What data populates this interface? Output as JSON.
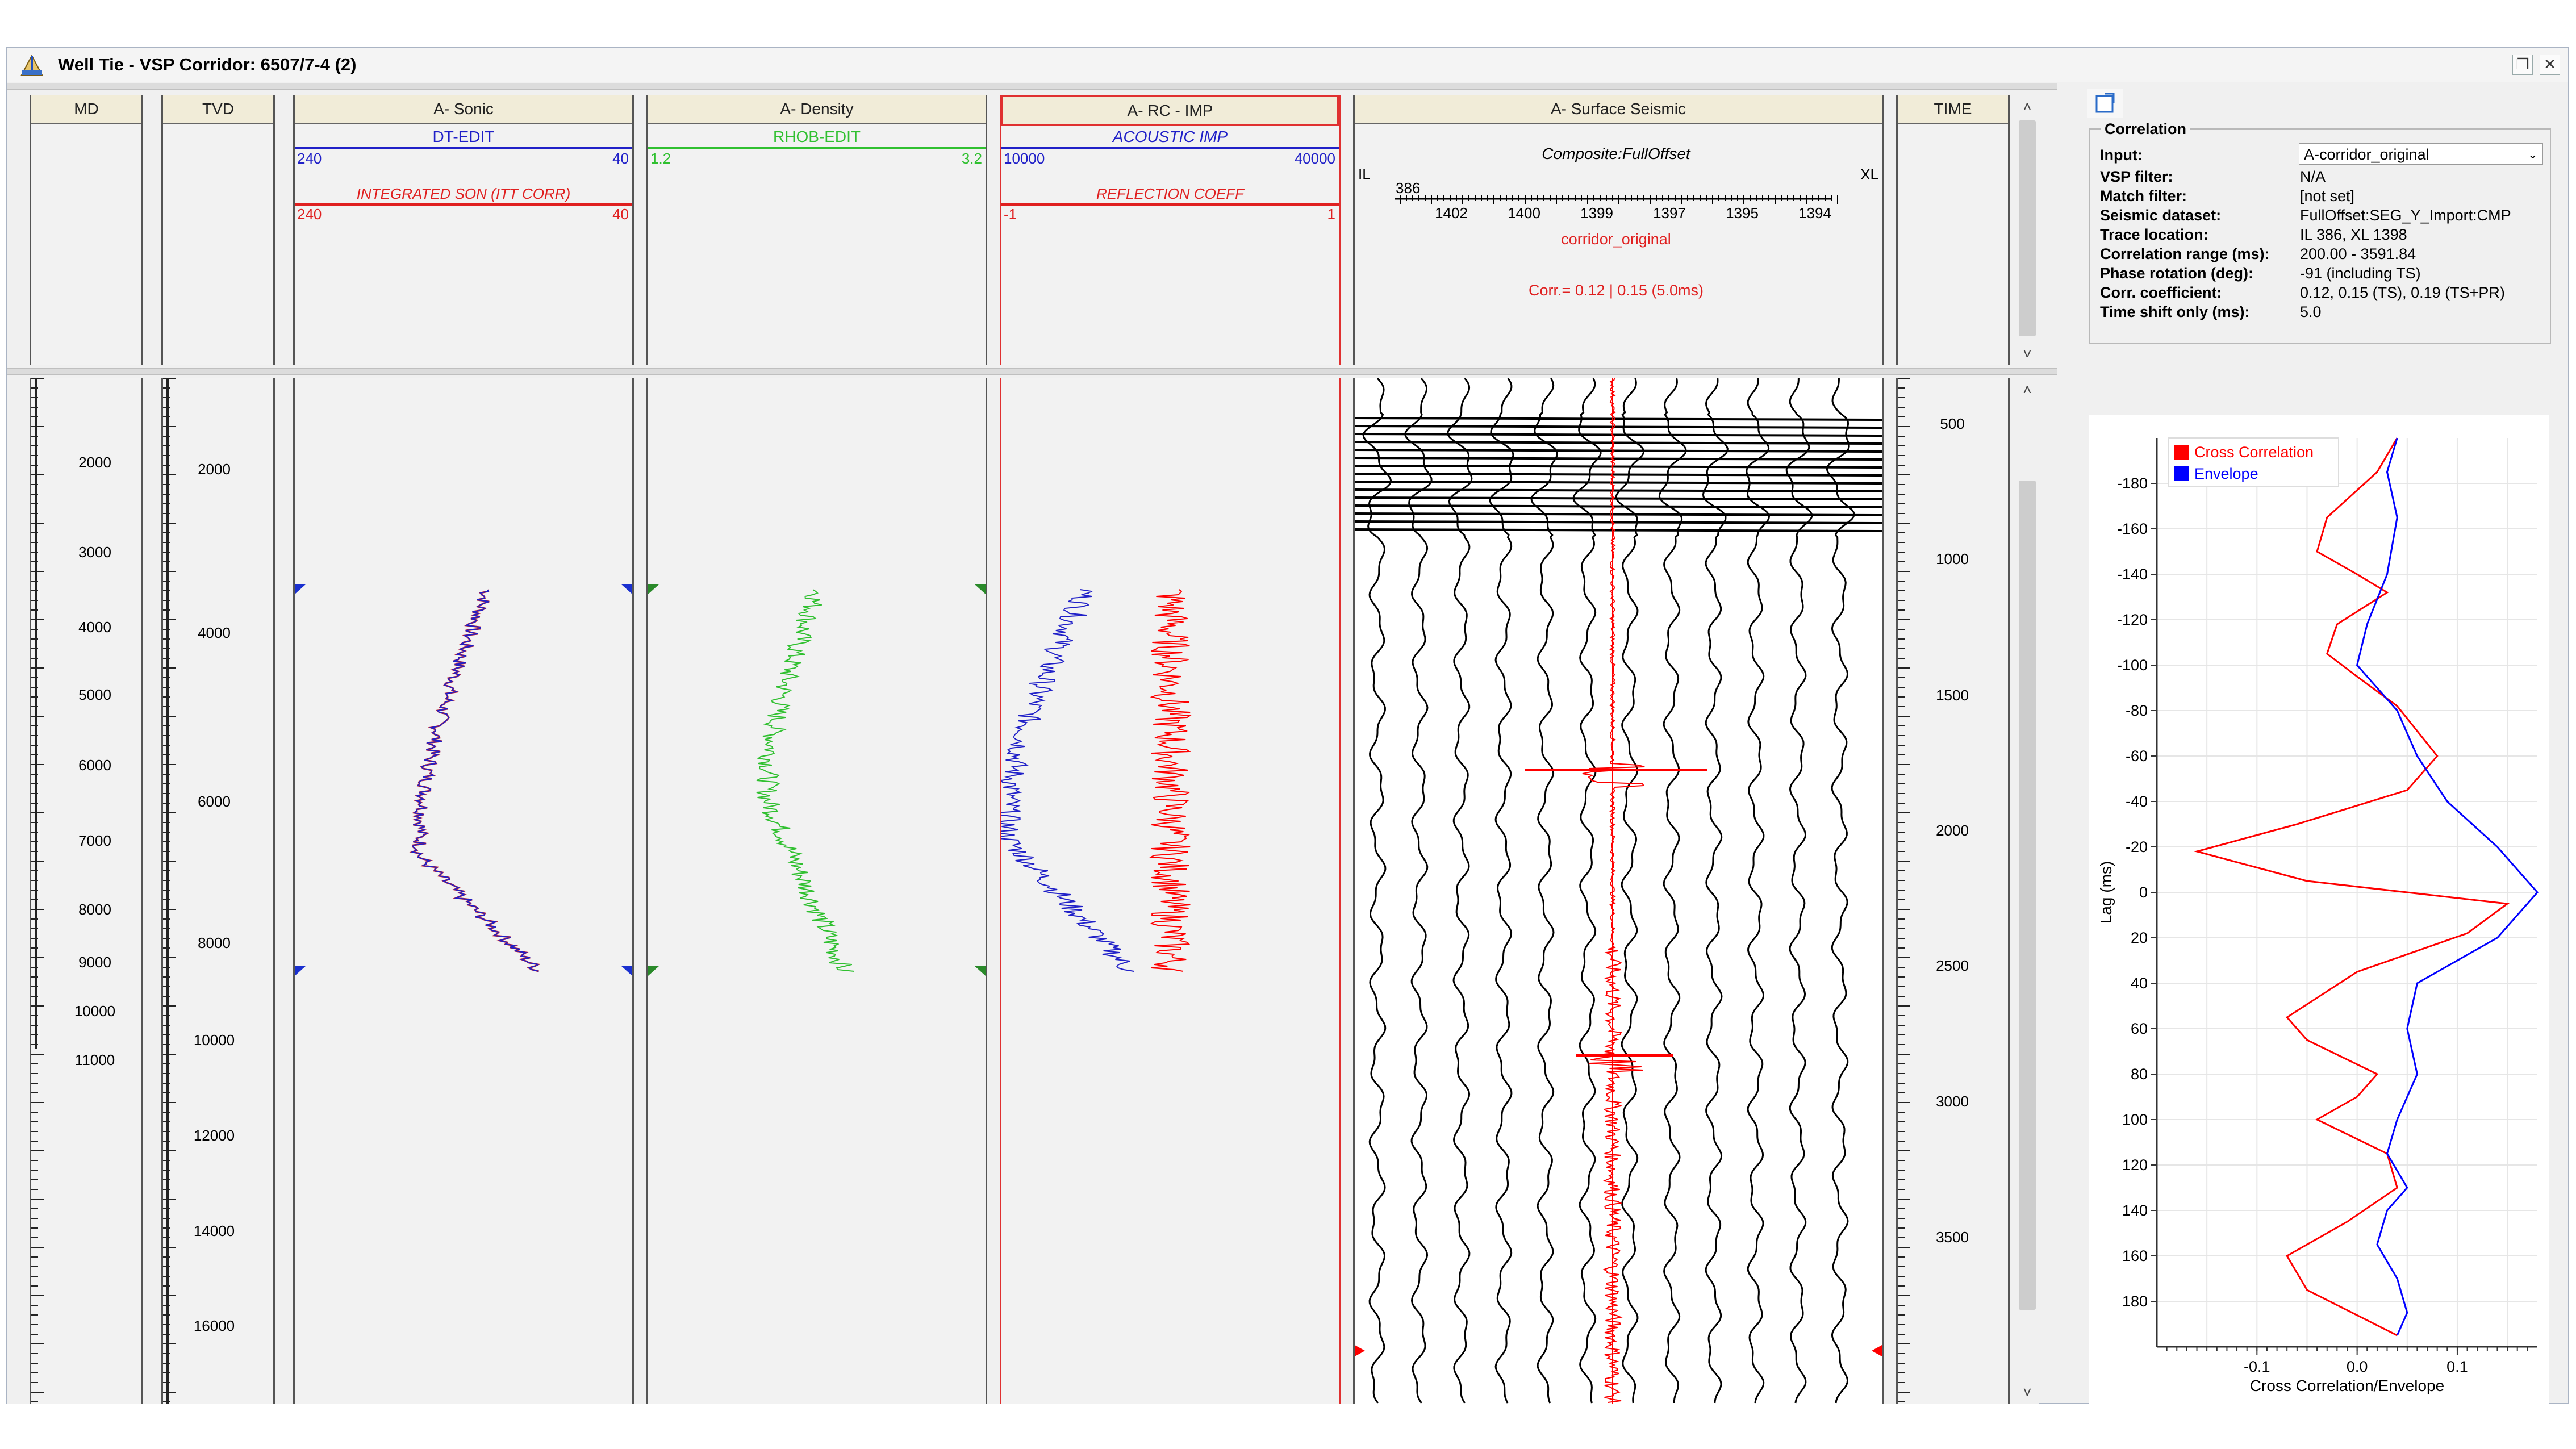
{
  "window": {
    "title": "Well Tie - VSP Corridor: 6507/7-4 (2)",
    "restore_glyph": "❐",
    "close_glyph": "✕"
  },
  "scroll": {
    "up": "˄",
    "down": "˅"
  },
  "tracks": {
    "md": {
      "title": "MD",
      "labels": [
        "2000",
        "3000",
        "4000",
        "5000",
        "6000",
        "7000",
        "8000",
        "9000",
        "10000",
        "11000"
      ]
    },
    "tvd": {
      "title": "TVD",
      "labels": [
        "2000",
        "4000",
        "6000",
        "8000",
        "10000",
        "12000",
        "14000",
        "16000"
      ]
    },
    "sonic": {
      "title": "A- Sonic",
      "curve1": {
        "name": "DT-EDIT",
        "min": "240",
        "max": "40",
        "color": "#2020c8"
      },
      "curve2": {
        "name": "INTEGRATED SON (ITT CORR)",
        "min": "240",
        "max": "40",
        "color": "#e02020"
      }
    },
    "density": {
      "title": "A- Density",
      "curve1": {
        "name": "RHOB-EDIT",
        "min": "1.2",
        "max": "3.2",
        "color": "#30c030"
      }
    },
    "rcimp": {
      "title": "A- RC - IMP",
      "curve1": {
        "name": "ACOUSTIC IMP",
        "min": "10000",
        "max": "40000",
        "color": "#2020c8"
      },
      "curve2": {
        "name": "REFLECTION COEFF",
        "min": "-1",
        "max": "1",
        "color": "#e02020"
      }
    },
    "seismic": {
      "title": "A- Surface Seismic",
      "composite": "Composite:FullOffset",
      "il_label": "IL",
      "il_value": "386",
      "xl_label": "XL",
      "xl_ticks": [
        "1402",
        "1400",
        "1399",
        "1397",
        "1395",
        "1394"
      ],
      "trace_name": "corridor_original",
      "corr_text": "Corr.= 0.12 | 0.15 (5.0ms)"
    },
    "time": {
      "title": "TIME",
      "labels": [
        "500",
        "1000",
        "1500",
        "2000",
        "2500",
        "3000",
        "3500"
      ]
    }
  },
  "correlation": {
    "legend": "Correlation",
    "input_label": "Input:",
    "input_value": "A-corridor_original",
    "rows": [
      {
        "label": "VSP filter:",
        "value": "N/A"
      },
      {
        "label": "Match filter:",
        "value": "[not set]"
      },
      {
        "label": "Seismic dataset:",
        "value": "FullOffset:SEG_Y_Import:CMP"
      },
      {
        "label": "Trace location:",
        "value": "IL 386, XL 1398"
      },
      {
        "label": "Correlation range (ms):",
        "value": "200.00 - 3591.84"
      },
      {
        "label": "Phase rotation (deg):",
        "value": "-91 (including TS)"
      },
      {
        "label": "Corr. coefficient:",
        "value": "0.12, 0.15 (TS), 0.19 (TS+PR)"
      },
      {
        "label": "Time shift only (ms):",
        "value": "5.0"
      }
    ]
  },
  "chart_data": {
    "type": "line",
    "title": "",
    "xlabel": "Cross Correlation/Envelope",
    "ylabel": "Lag (ms)",
    "xlim": [
      -0.2,
      0.18
    ],
    "ylim": [
      -200,
      200
    ],
    "x_ticks": [
      "-0.1",
      "0.0",
      "0.1"
    ],
    "y_ticks": [
      "-180",
      "-160",
      "-140",
      "-120",
      "-100",
      "-80",
      "-60",
      "-40",
      "-20",
      "0",
      "20",
      "40",
      "60",
      "80",
      "100",
      "120",
      "140",
      "160",
      "180"
    ],
    "legend_position": "top-left",
    "series": [
      {
        "name": "Cross Correlation",
        "color": "#ff0000",
        "x": [
          0.04,
          0.02,
          -0.03,
          -0.04,
          0.0,
          0.03,
          -0.02,
          -0.03,
          0.0,
          0.04,
          0.08,
          0.05,
          -0.06,
          -0.16,
          -0.05,
          0.15,
          0.11,
          0.0,
          -0.07,
          -0.05,
          0.02,
          0.0,
          -0.04,
          0.03,
          0.04,
          -0.01,
          -0.07,
          -0.05,
          0.04
        ],
        "y": [
          -200,
          -185,
          -165,
          -150,
          -140,
          -132,
          -118,
          -105,
          -95,
          -82,
          -60,
          -45,
          -30,
          -18,
          -5,
          5,
          18,
          35,
          55,
          65,
          80,
          90,
          100,
          115,
          130,
          145,
          160,
          175,
          195
        ]
      },
      {
        "name": "Envelope",
        "color": "#0000ff",
        "x": [
          0.04,
          0.03,
          0.04,
          0.03,
          0.01,
          0.0,
          0.04,
          0.06,
          0.09,
          0.14,
          0.18,
          0.14,
          0.06,
          0.05,
          0.06,
          0.04,
          0.03,
          0.05,
          0.03,
          0.02,
          0.04,
          0.05,
          0.04
        ],
        "y": [
          -200,
          -185,
          -165,
          -140,
          -118,
          -100,
          -80,
          -60,
          -40,
          -20,
          0,
          20,
          40,
          60,
          80,
          100,
          115,
          130,
          140,
          155,
          170,
          185,
          195
        ]
      }
    ]
  }
}
